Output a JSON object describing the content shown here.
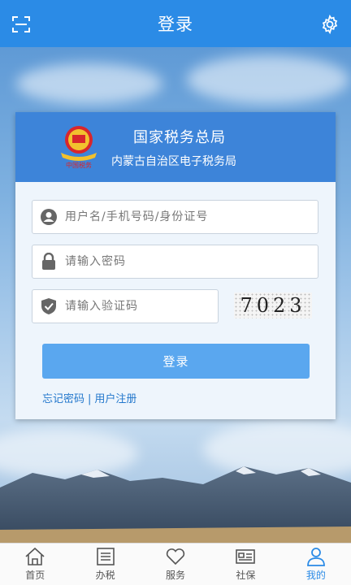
{
  "header": {
    "title": "登录"
  },
  "card": {
    "org_name": "国家税务总局",
    "org_sub": "内蒙古自治区电子税务局",
    "emblem_text": "中国税务"
  },
  "form": {
    "username_placeholder": "用户名/手机号码/身份证号",
    "password_placeholder": "请输入密码",
    "captcha_placeholder": "请输入验证码",
    "captcha_code": "7023",
    "login_label": "登录",
    "forgot_label": "忘记密码",
    "separator": "|",
    "register_label": "用户注册"
  },
  "tabs": [
    {
      "label": "首页",
      "icon": "home-icon"
    },
    {
      "label": "办税",
      "icon": "list-icon"
    },
    {
      "label": "服务",
      "icon": "heart-icon"
    },
    {
      "label": "社保",
      "icon": "card-icon"
    },
    {
      "label": "我的",
      "icon": "user-icon",
      "active": true
    }
  ],
  "colors": {
    "accent": "#2b8be6",
    "card_header": "#3d84d9",
    "button": "#5aa7ef",
    "link": "#2277cc"
  }
}
